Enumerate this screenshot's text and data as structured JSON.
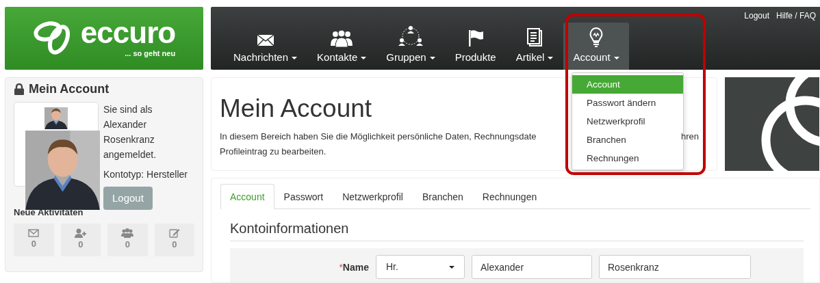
{
  "brand": {
    "name": "eccuro",
    "tagline": "... so geht neu"
  },
  "top_links": [
    "Logout",
    "Hilfe / FAQ"
  ],
  "nav": [
    {
      "label": "Nachrichten",
      "kind": "envelope",
      "dropdown": true,
      "selected": false
    },
    {
      "label": "Kontakte",
      "kind": "people",
      "dropdown": true,
      "selected": false
    },
    {
      "label": "Gruppen",
      "kind": "network",
      "dropdown": true,
      "selected": false
    },
    {
      "label": "Produkte",
      "kind": "flag",
      "dropdown": false,
      "selected": false
    },
    {
      "label": "Artikel",
      "kind": "document",
      "dropdown": true,
      "selected": false
    },
    {
      "label": "Account",
      "kind": "bulb",
      "dropdown": true,
      "selected": true
    }
  ],
  "account_menu": [
    {
      "label": "Account",
      "selected": true
    },
    {
      "label": "Passwort ändern",
      "selected": false
    },
    {
      "label": "Netzwerkprofil",
      "selected": false
    },
    {
      "label": "Branchen",
      "selected": false
    },
    {
      "label": "Rechnungen",
      "selected": false
    }
  ],
  "sidebar": {
    "title": "Mein Account",
    "login_text": "Sie sind als Alexander Rosenkranz angemeldet.",
    "account_type": "Kontotyp: Hersteller",
    "logout_button": "Logout",
    "activities_title": "Neue Aktivitäten",
    "activities": [
      {
        "kind": "messages",
        "count": "0"
      },
      {
        "kind": "contacts",
        "count": "0"
      },
      {
        "kind": "groups",
        "count": "0"
      },
      {
        "kind": "edits",
        "count": "0"
      }
    ]
  },
  "header": {
    "title": "Mein Account",
    "description_start": "In diesem Bereich haben Sie die Möglichkeit persönliche Daten, Rechnungsdate",
    "description_end": "hren",
    "description_line2": "Profileintrag zu bearbeiten."
  },
  "tabs": [
    {
      "label": "Account",
      "selected": true
    },
    {
      "label": "Passwort",
      "selected": false
    },
    {
      "label": "Netzwerkprofil",
      "selected": false
    },
    {
      "label": "Branchen",
      "selected": false
    },
    {
      "label": "Rechnungen",
      "selected": false
    }
  ],
  "section_title": "Kontoinformationen",
  "form": {
    "label": "Name",
    "required": true,
    "required_mark": "*",
    "salutation": "Hr.",
    "first_name": "Alexander",
    "last_name": "Rosenkranz"
  }
}
